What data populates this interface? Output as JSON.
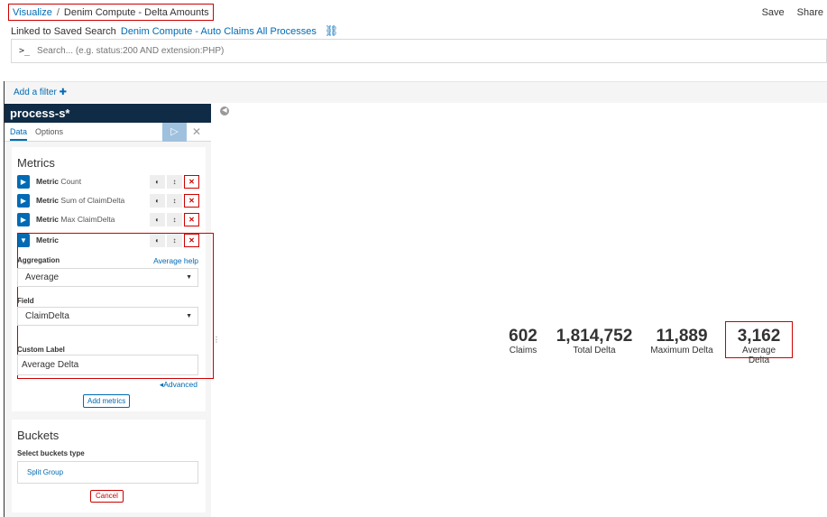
{
  "breadcrumb": {
    "root": "Visualize",
    "separator": "/",
    "current": "Denim Compute - Delta Amounts"
  },
  "top_actions": {
    "save": "Save",
    "share": "Share"
  },
  "linked": {
    "prefix": "Linked to Saved Search",
    "search_name": "Denim Compute - Auto Claims All Processes"
  },
  "search": {
    "prompt": ">_",
    "placeholder": "Search... (e.g. status:200 AND extension:PHP)"
  },
  "filter": {
    "add_label": "Add a filter",
    "plus": "✚"
  },
  "sidebar": {
    "index_pattern": "process-s*",
    "tabs": [
      "Data",
      "Options"
    ],
    "metrics_title": "Metrics",
    "metrics": [
      {
        "kind": "Metric",
        "label": "Count"
      },
      {
        "kind": "Metric",
        "label": "Sum of ClaimDelta"
      },
      {
        "kind": "Metric",
        "label": "Max ClaimDelta"
      },
      {
        "kind": "Metric",
        "label": ""
      }
    ],
    "editor": {
      "aggregation_label": "Aggregation",
      "aggregation_help": "Average help",
      "aggregation_value": "Average",
      "field_label": "Field",
      "field_value": "ClaimDelta",
      "custom_label_label": "Custom Label",
      "custom_label_value": "Average Delta"
    },
    "advanced": "Advanced",
    "add_metrics": "Add metrics",
    "buckets_title": "Buckets",
    "buckets_select_label": "Select buckets type",
    "split_group": "Split Group",
    "cancel": "Cancel"
  },
  "stats": [
    {
      "value": "602",
      "label": "Claims"
    },
    {
      "value": "1,814,752",
      "label": "Total Delta"
    },
    {
      "value": "11,889",
      "label": "Maximum Delta"
    },
    {
      "value": "3,162",
      "label": "Average Delta"
    }
  ]
}
